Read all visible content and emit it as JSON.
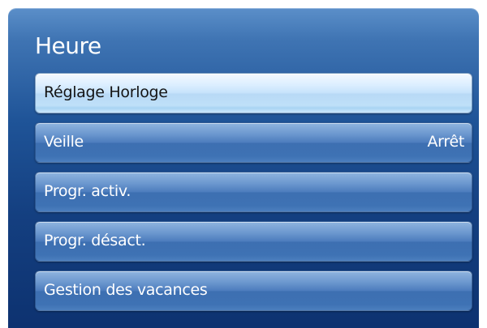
{
  "menu": {
    "title": "Heure",
    "items": [
      {
        "label": "Réglage Horloge",
        "value": "",
        "selected": true
      },
      {
        "label": "Veille",
        "value": "Arrêt",
        "selected": false
      },
      {
        "label": "Progr. activ.",
        "value": "",
        "selected": false
      },
      {
        "label": "Progr. désact.",
        "value": "",
        "selected": false
      },
      {
        "label": "Gestion des vacances",
        "value": "",
        "selected": false
      }
    ]
  }
}
